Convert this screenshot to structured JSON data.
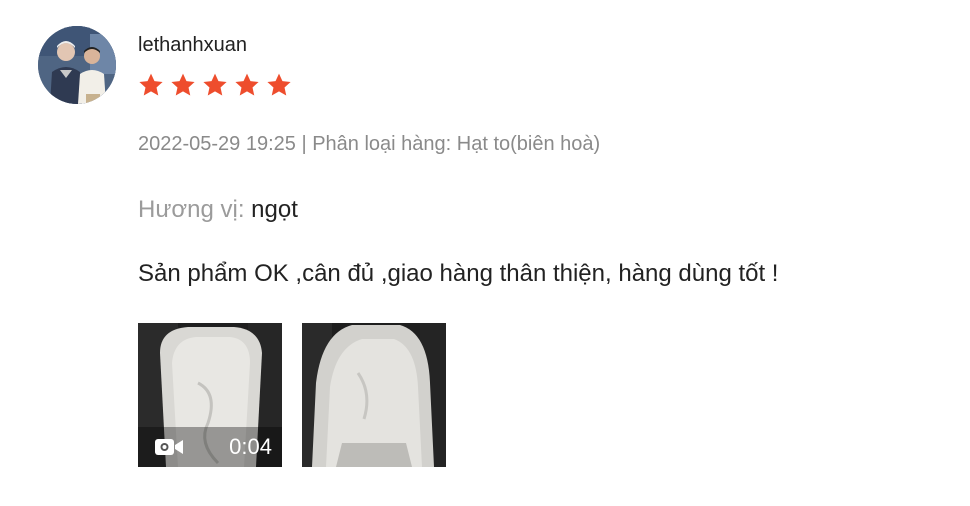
{
  "review": {
    "username": "lethanhxuan",
    "rating": 5,
    "star_color": "#ee4d2d",
    "meta": "2022-05-29 19:25 | Phân loại hàng: Hạt to(biên hoà)",
    "attribute": {
      "label": "Hương vị:",
      "value": "ngọt"
    },
    "comment": "Sản phẩm OK ,cân đủ ,giao hàng thân thiện, hàng dùng tốt !",
    "media": {
      "video": {
        "icon": "video-camera-icon",
        "duration": "0:04"
      },
      "image": {
        "icon": "photo"
      }
    }
  }
}
